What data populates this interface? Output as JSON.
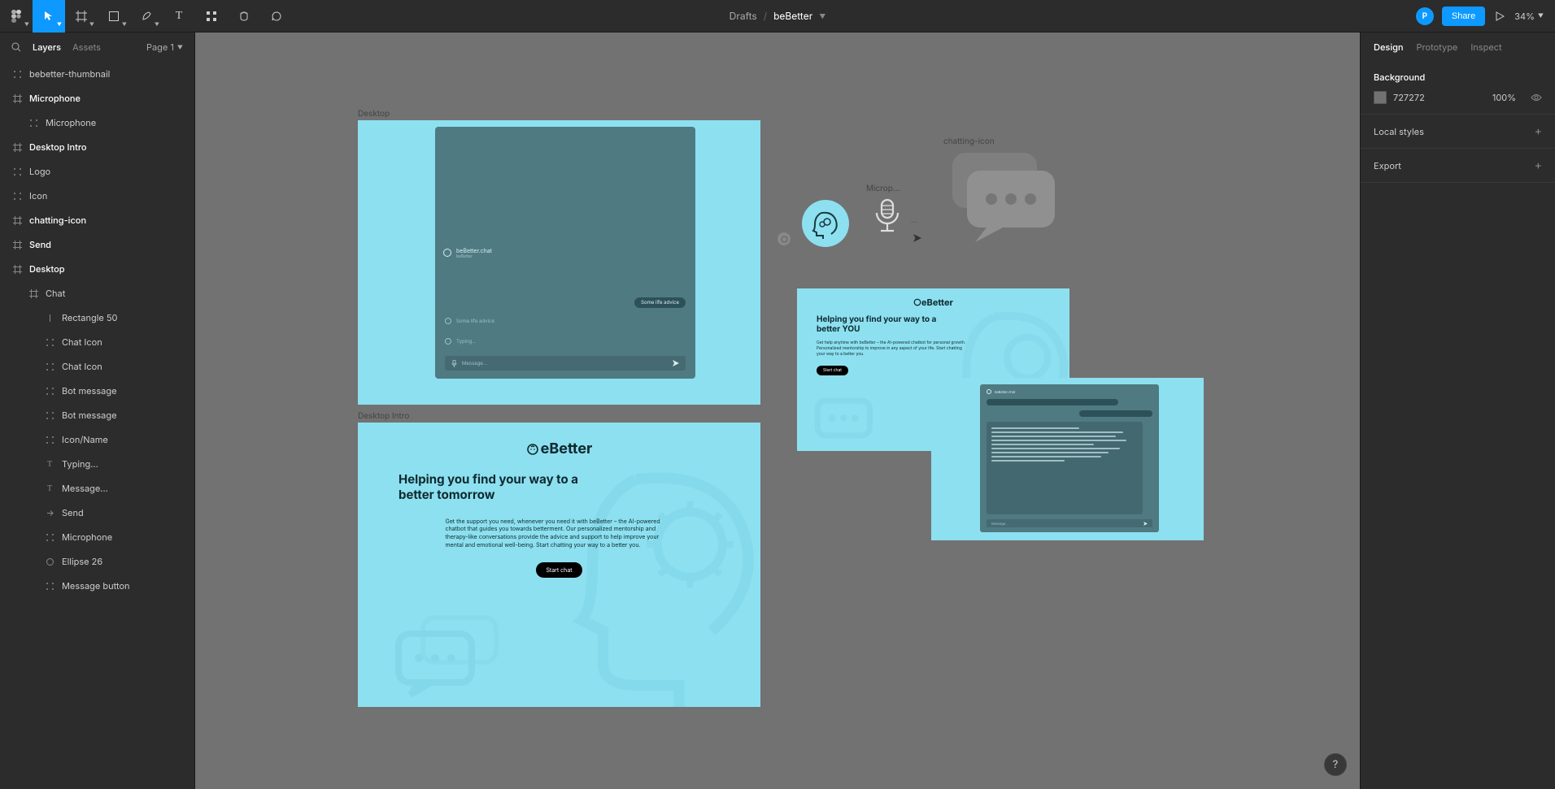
{
  "toolbar": {
    "breadcrumb_root": "Drafts",
    "breadcrumb_sep": "/",
    "breadcrumb_file": "beBetter",
    "avatar_initial": "P",
    "share_label": "Share",
    "zoom": "34%"
  },
  "left_panel": {
    "tab_layers": "Layers",
    "tab_assets": "Assets",
    "page_label": "Page 1",
    "layers": [
      {
        "name": "bebetter-thumbnail",
        "type": "component",
        "bold": false
      },
      {
        "name": "Microphone",
        "type": "frame",
        "bold": true
      },
      {
        "name": "Microphone",
        "type": "component",
        "bold": false,
        "indent": 1
      },
      {
        "name": "Desktop Intro",
        "type": "frame",
        "bold": true
      },
      {
        "name": "Logo",
        "type": "component",
        "bold": false
      },
      {
        "name": "Icon",
        "type": "component",
        "bold": false
      },
      {
        "name": "chatting-icon",
        "type": "frame",
        "bold": true
      },
      {
        "name": "Send",
        "type": "frame",
        "bold": true
      },
      {
        "name": "Desktop",
        "type": "frame",
        "bold": true
      },
      {
        "name": "Chat",
        "type": "frame",
        "bold": false,
        "indent": 1
      },
      {
        "name": "Rectangle 50",
        "type": "rect",
        "bold": false,
        "indent": 2
      },
      {
        "name": "Chat Icon",
        "type": "component",
        "bold": false,
        "indent": 2
      },
      {
        "name": "Chat Icon",
        "type": "component",
        "bold": false,
        "indent": 2
      },
      {
        "name": "Bot message",
        "type": "component",
        "bold": false,
        "indent": 2
      },
      {
        "name": "Bot message",
        "type": "component",
        "bold": false,
        "indent": 2
      },
      {
        "name": "Icon/Name",
        "type": "component",
        "bold": false,
        "indent": 2
      },
      {
        "name": "Typing...",
        "type": "text",
        "bold": false,
        "indent": 2
      },
      {
        "name": "Message...",
        "type": "text",
        "bold": false,
        "indent": 2
      },
      {
        "name": "Send",
        "type": "instance",
        "bold": false,
        "indent": 2
      },
      {
        "name": "Microphone",
        "type": "component",
        "bold": false,
        "indent": 2
      },
      {
        "name": "Ellipse 26",
        "type": "ellipse",
        "bold": false,
        "indent": 2
      },
      {
        "name": "Message button",
        "type": "component",
        "bold": false,
        "indent": 2
      }
    ]
  },
  "right_panel": {
    "tab_design": "Design",
    "tab_prototype": "Prototype",
    "tab_inspect": "Inspect",
    "section_bg": "Background",
    "bg_hex": "727272",
    "bg_pct": "100%",
    "section_local": "Local styles",
    "section_export": "Export"
  },
  "canvas": {
    "label_desktop": "Desktop",
    "label_intro": "Desktop Intro",
    "label_chat_icon": "chatting-icon",
    "label_microp": "Microp...",
    "chat": {
      "title": "beBetter.chat",
      "subtitle": "beBetter",
      "bot1": "Some life advice",
      "bot2": "Typing...",
      "user1": "Some life advice",
      "input_placeholder": "Message..."
    },
    "intro": {
      "brand": "eBetter",
      "headline": "Helping you find your way to a better tomorrow",
      "sub": "Get the support you need, whenever you need it with beBetter – the AI-powered chatbot that guides you towards betterment. Our personalized mentorship and therapy-like conversations provide the advice and support to help improve your mental and emotional well-being. Start chatting your way to a better you.",
      "start": "Start chat"
    },
    "small_intro": {
      "brand": "eBetter",
      "headline": "Helping you find your way to a better YOU",
      "sub": "Get help anytime with beBetter – the AI-powered chatbot for personal growth. Personalized mentorship to improve in any aspect of your life. Start chatting your way to a better you.",
      "start": "Start chat"
    }
  }
}
